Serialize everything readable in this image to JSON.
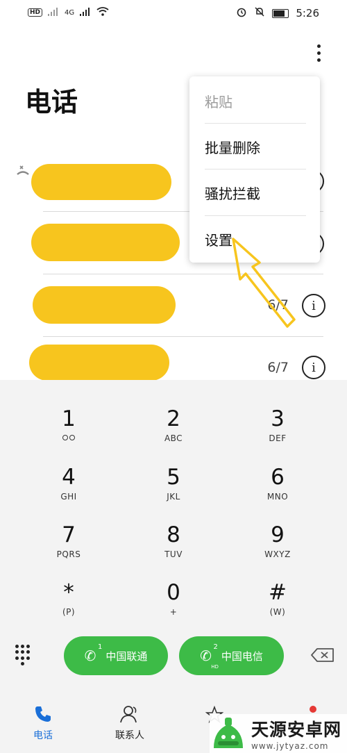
{
  "status_bar": {
    "left_label": "HD",
    "network_label": "4G",
    "time": "5:26"
  },
  "header": {
    "title": "电话"
  },
  "call_list": [
    {
      "date": "",
      "has_info": true
    },
    {
      "date": "",
      "has_info": true
    },
    {
      "date": "6/7",
      "has_info": true
    },
    {
      "date": "6/7",
      "has_info": true
    }
  ],
  "menu": {
    "items": [
      {
        "label": "粘贴",
        "enabled": false
      },
      {
        "label": "批量删除",
        "enabled": true
      },
      {
        "label": "骚扰拦截",
        "enabled": true
      },
      {
        "label": "设置",
        "enabled": true
      }
    ]
  },
  "dialpad": {
    "keys": [
      {
        "num": "1",
        "sub": ""
      },
      {
        "num": "2",
        "sub": "ABC"
      },
      {
        "num": "3",
        "sub": "DEF"
      },
      {
        "num": "4",
        "sub": "GHI"
      },
      {
        "num": "5",
        "sub": "JKL"
      },
      {
        "num": "6",
        "sub": "MNO"
      },
      {
        "num": "7",
        "sub": "PQRS"
      },
      {
        "num": "8",
        "sub": "TUV"
      },
      {
        "num": "9",
        "sub": "WXYZ"
      },
      {
        "num": "*",
        "sub": "(P)"
      },
      {
        "num": "0",
        "sub": "+"
      },
      {
        "num": "#",
        "sub": "(W)"
      }
    ],
    "sim1_label": "中国联通",
    "sim1_slot": "1",
    "sim2_label": "中国电信",
    "sim2_slot": "2",
    "sim2_badge": "HD"
  },
  "nav": {
    "items": [
      {
        "label": "电话",
        "icon": "phone-icon",
        "active": true
      },
      {
        "label": "联系人",
        "icon": "contacts-icon",
        "active": false
      }
    ]
  },
  "watermark": {
    "name": "天源安卓网",
    "url": "www.jytyaz.com"
  },
  "colors": {
    "accent_green": "#3dbb47",
    "nav_active": "#1a6fd8",
    "highlight_arrow": "#f7c51e"
  }
}
